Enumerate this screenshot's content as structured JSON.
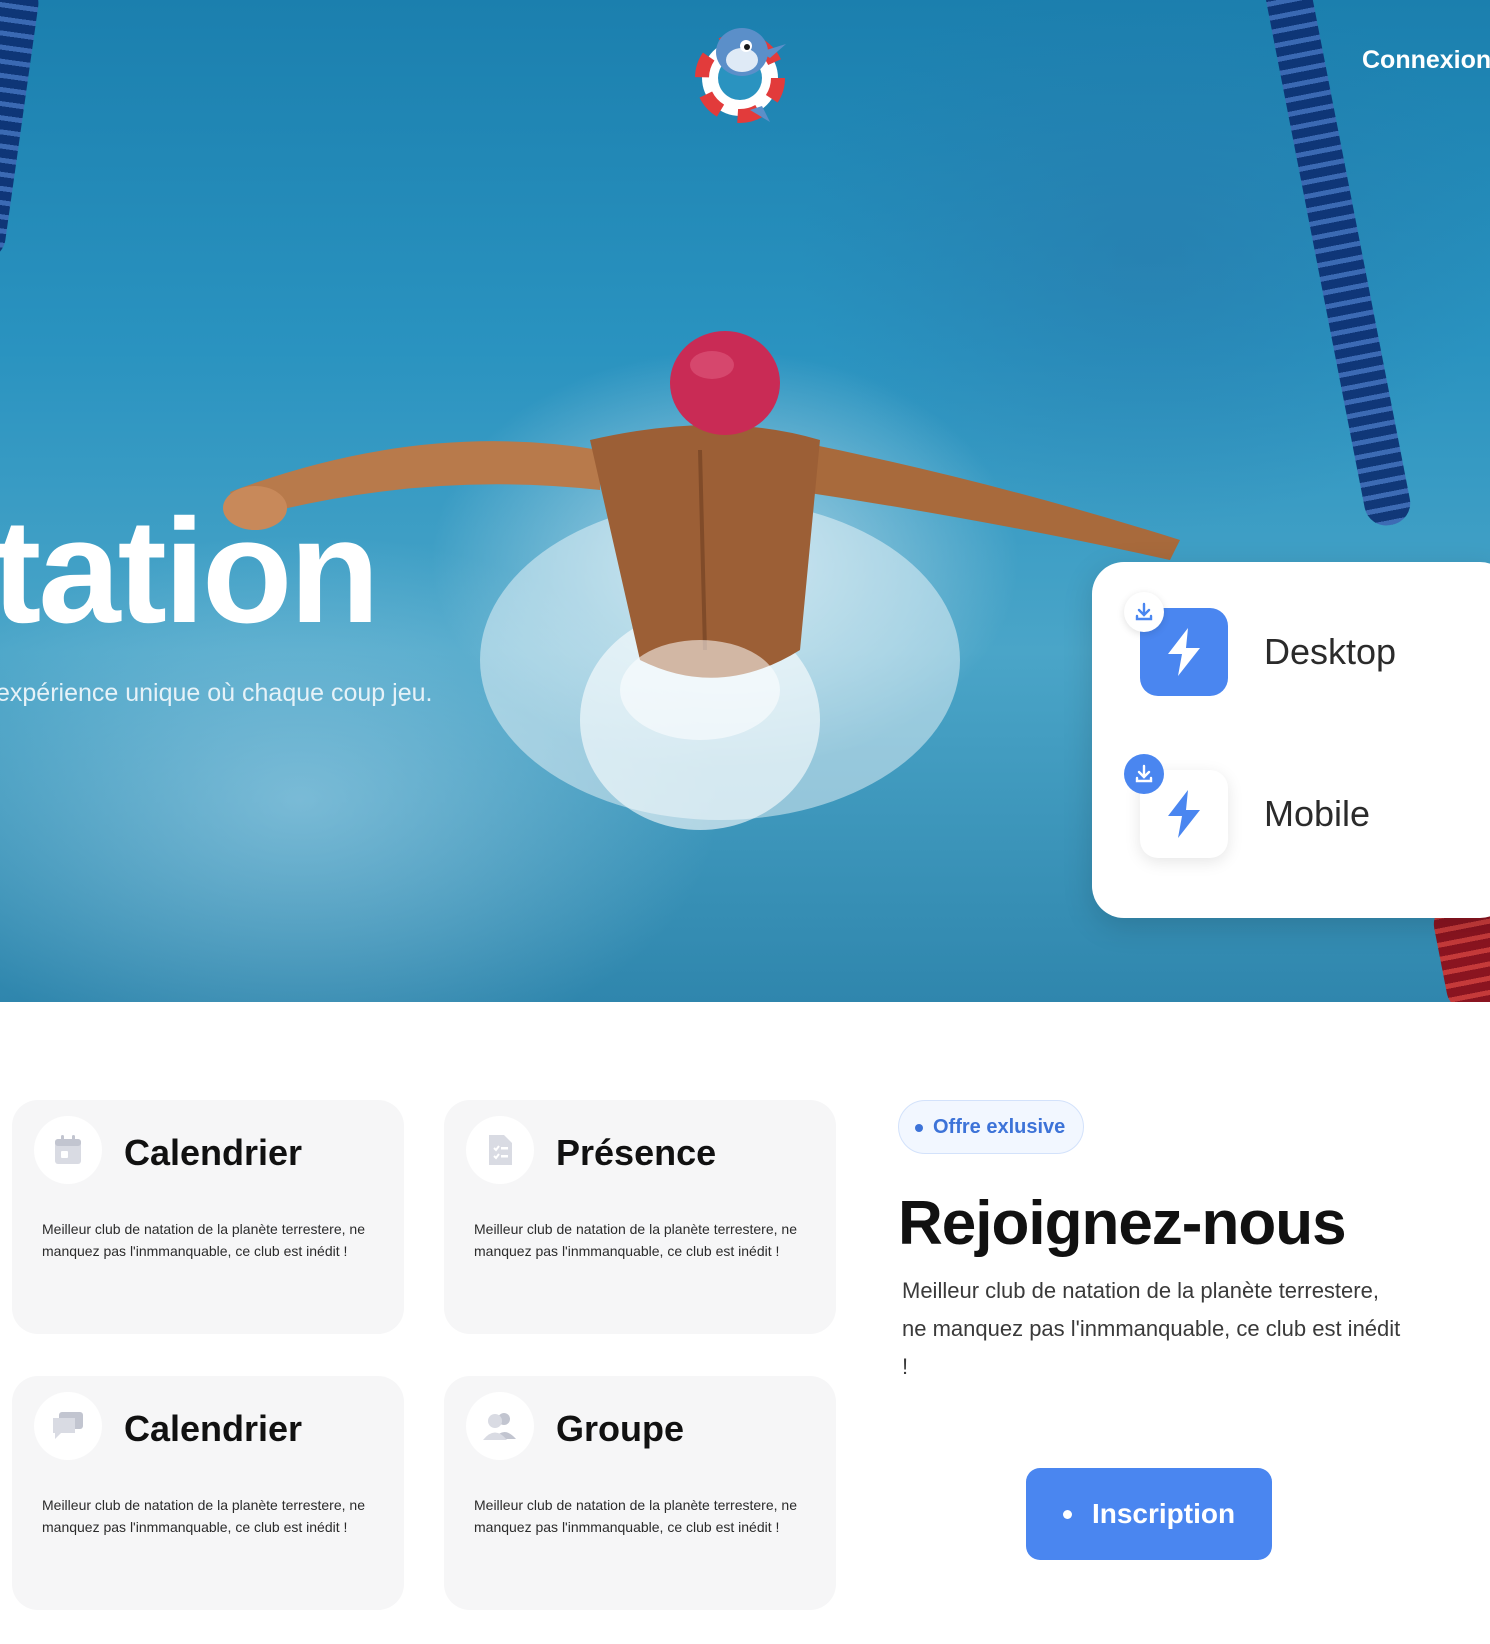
{
  "nav": {
    "login_label": "Connexion"
  },
  "hero": {
    "title": "tation",
    "subtitle": "expérience unique où chaque coup jeu."
  },
  "downloads": [
    {
      "label": "Desktop",
      "icon": "download-icon"
    },
    {
      "label": "Mobile",
      "icon": "download-icon"
    }
  ],
  "features": [
    {
      "title": "Calendrier",
      "text": "Meilleur club de natation de la planète terrestere, ne manquez pas l'inmmanquable, ce club est inédit !",
      "icon": "calendar-icon"
    },
    {
      "title": "Présence",
      "text": "Meilleur club de natation de la planète terrestere, ne manquez pas l'inmmanquable, ce club est inédit !",
      "icon": "checklist-icon"
    },
    {
      "title": "Calendrier",
      "text": "Meilleur club de natation de la planète terrestere, ne manquez pas l'inmmanquable, ce club est inédit !",
      "icon": "chat-icon"
    },
    {
      "title": "Groupe",
      "text": "Meilleur club de natation de la planète terrestere, ne manquez pas l'inmmanquable, ce club est inédit !",
      "icon": "users-icon"
    }
  ],
  "join": {
    "badge": "Offre exlusive",
    "title": "Rejoignez-nous",
    "text": "Meilleur club de natation de la planète terrestere, ne manquez pas l'inmmanquable, ce club est inédit !",
    "button_label": "Inscription"
  },
  "colors": {
    "accent": "#4a86f0",
    "water": "#2a93c0",
    "card_bg": "#f6f6f7"
  }
}
